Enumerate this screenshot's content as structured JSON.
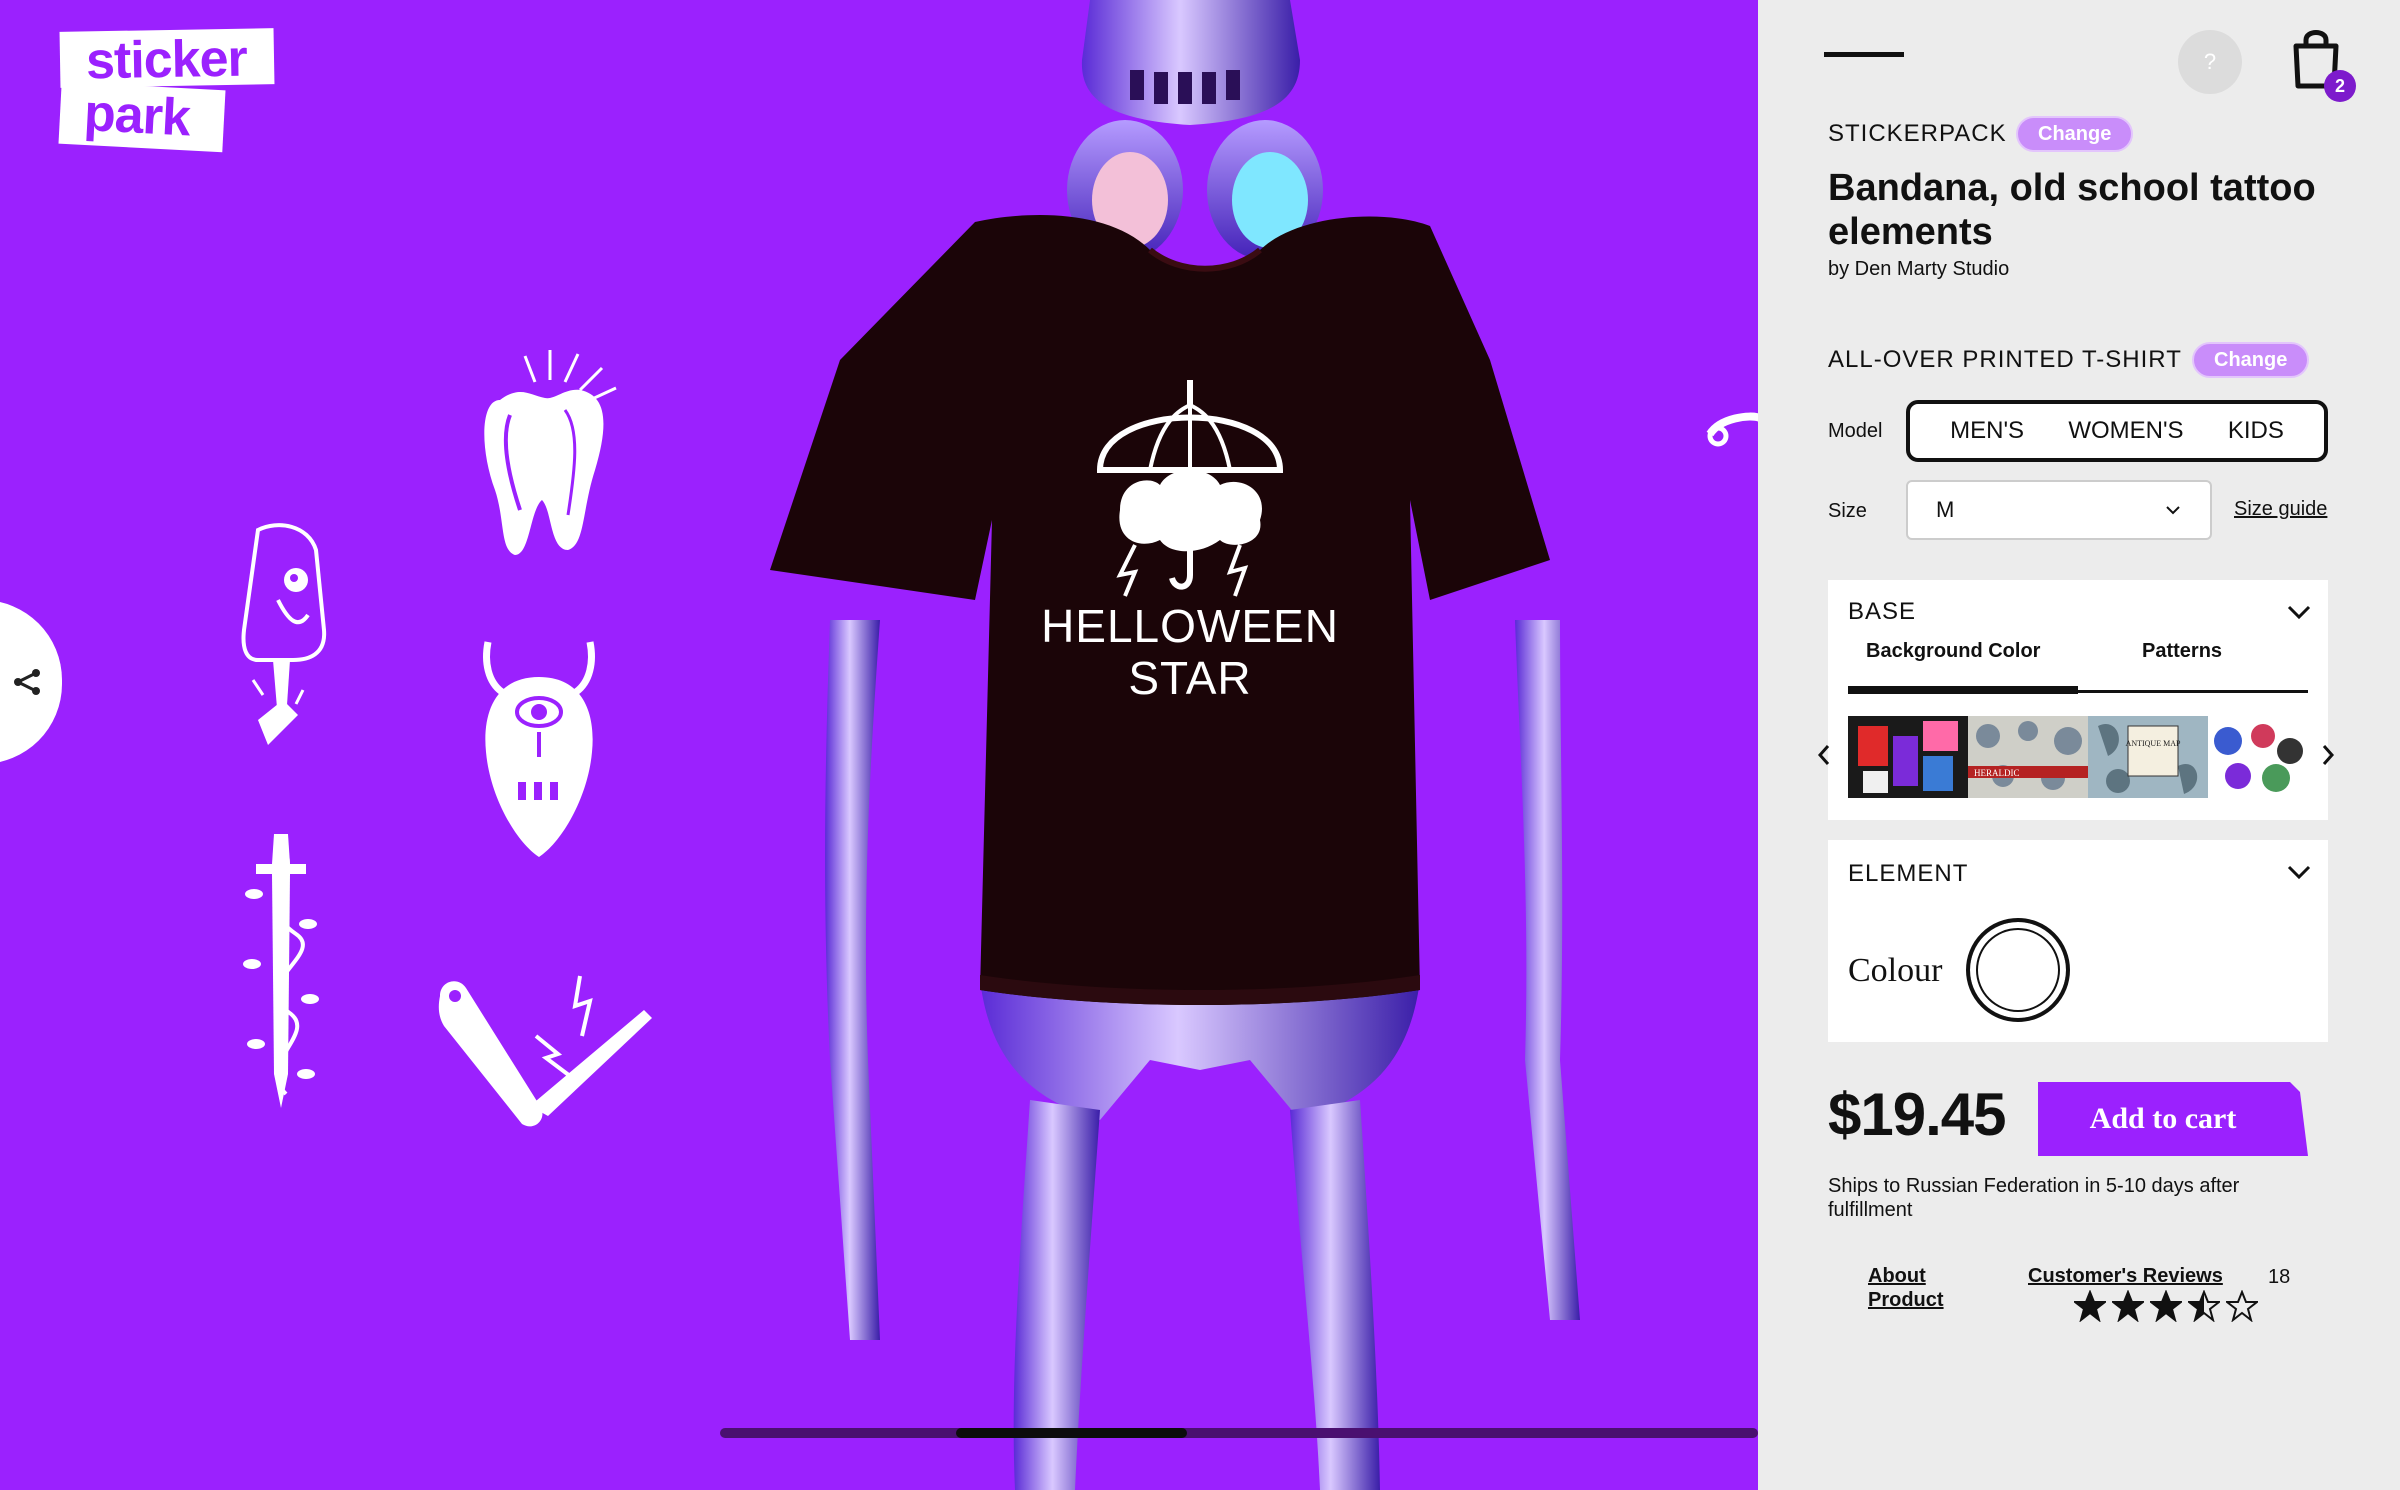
{
  "brand": {
    "line1": "sticker",
    "line2": "park"
  },
  "colors": {
    "stage_bg": "#9b21fe",
    "accent": "#7d1bcc",
    "panel_bg": "#ececec"
  },
  "stage": {
    "share_icon": "share-icon",
    "shirt_print": {
      "line1": "HELLOWEEN",
      "line2": "STAR"
    },
    "stickers": [
      "tooth-sticker",
      "popsicle-skull-sticker",
      "horned-eye-mask-sticker",
      "vine-dagger-sticker",
      "folding-knife-sticker"
    ],
    "slider_progress": {
      "start": 0.227,
      "end": 0.45
    }
  },
  "header": {
    "menu_icon": "menu-icon",
    "help_label": "?",
    "cart_icon": "shopping-bag-icon",
    "cart_count": "2"
  },
  "sticker_pack": {
    "eyebrow": "STICKERPACK",
    "change_label": "Change",
    "title": "Bandana, old school tattoo elements",
    "author": "by Den Marty Studio"
  },
  "product": {
    "eyebrow": "ALL-OVER PRINTED T-SHIRT",
    "change_label": "Change",
    "model_label": "Model",
    "models": [
      "MEN'S",
      "WOMEN'S",
      "KIDS"
    ],
    "size_label": "Size",
    "size_value": "M",
    "size_guide": "Size guide"
  },
  "base": {
    "title": "BASE",
    "tabs": [
      "Background Color",
      "Patterns"
    ],
    "active_tab": "Background Color",
    "thumb_labels": [
      "HERALDIC",
      "ANTIQUE MAP"
    ]
  },
  "element": {
    "title": "ELEMENT",
    "colour_label": "Colour",
    "colour_value": "#ffffff"
  },
  "purchase": {
    "price": "$19.45",
    "add_to_cart": "Add to cart",
    "shipping": "Ships to Russian Federation in 5-10 days after fulfillment"
  },
  "footer": {
    "about_line1": "About",
    "about_line2": "Product",
    "reviews_label": "Customer's Reviews",
    "review_count": "18",
    "rating": 3.5
  }
}
